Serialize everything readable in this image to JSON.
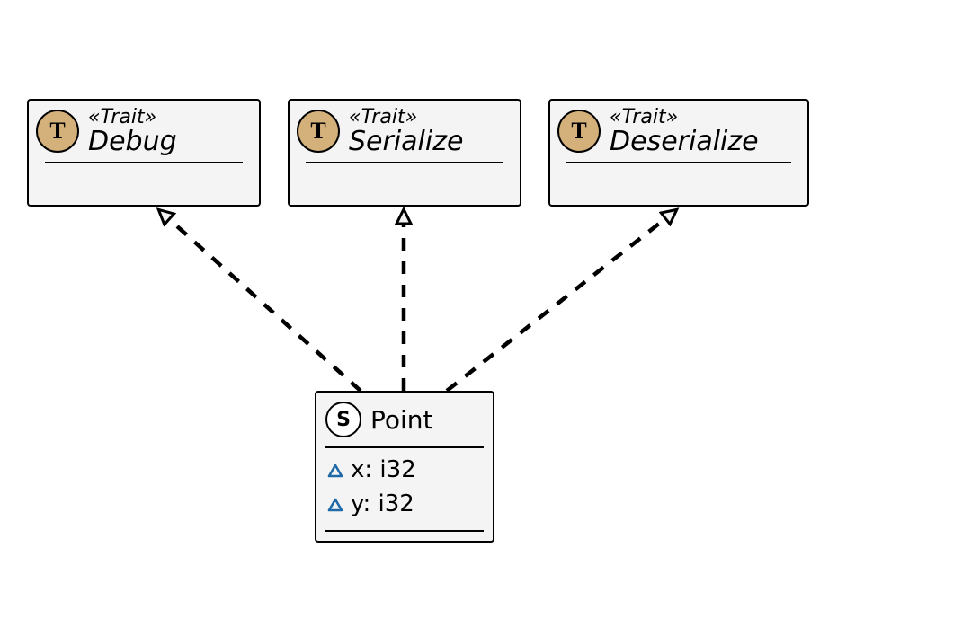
{
  "traits": [
    {
      "stereotype": "«Trait»",
      "name": "Debug",
      "badge": "T"
    },
    {
      "stereotype": "«Trait»",
      "name": "Serialize",
      "badge": "T"
    },
    {
      "stereotype": "«Trait»",
      "name": "Deserialize",
      "badge": "T"
    }
  ],
  "struct": {
    "badge": "S",
    "name": "Point",
    "fields": [
      {
        "name": "x",
        "type": "i32"
      },
      {
        "name": "y",
        "type": "i32"
      }
    ]
  },
  "relations": [
    {
      "from": "struct",
      "to": "trait-debug",
      "kind": "realization"
    },
    {
      "from": "struct",
      "to": "trait-serialize",
      "kind": "realization"
    },
    {
      "from": "struct",
      "to": "trait-deserialize",
      "kind": "realization"
    }
  ],
  "colors": {
    "trait_badge_bg": "#d4b07a",
    "struct_badge_bg": "#ffffff",
    "field_marker_stroke": "#1e6aa8",
    "box_bg": "#f4f4f4"
  }
}
